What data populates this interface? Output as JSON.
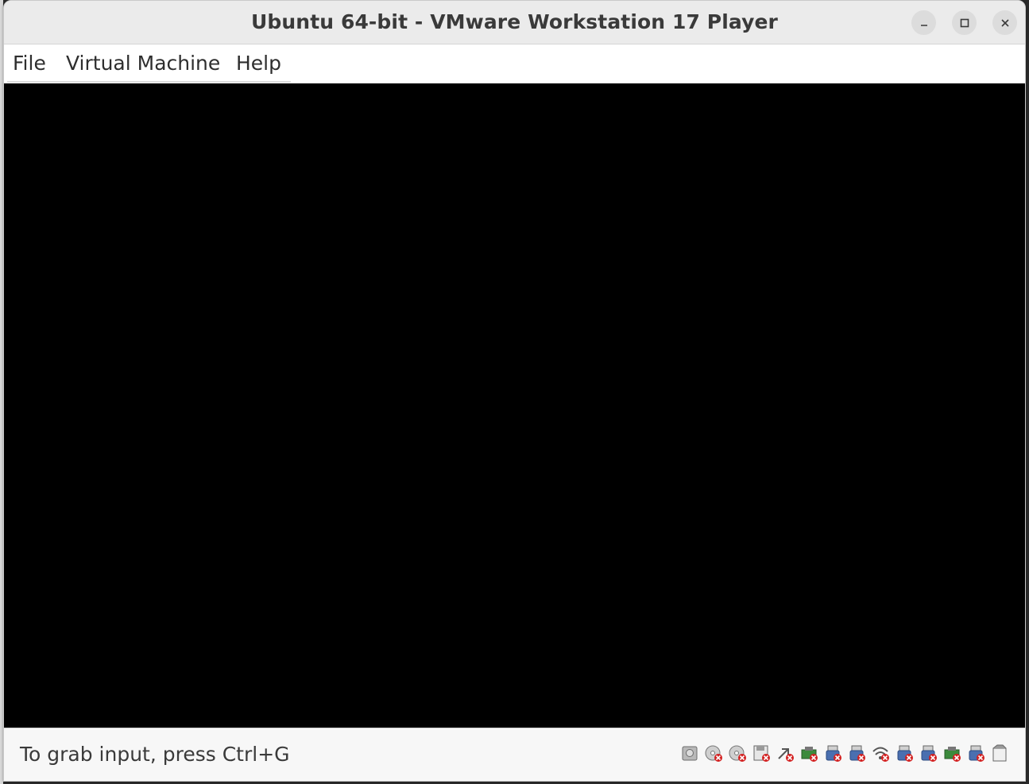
{
  "window": {
    "title": "Ubuntu 64-bit - VMware Workstation 17 Player"
  },
  "window_controls": {
    "minimize": "–",
    "maximize": "□",
    "close": "✕"
  },
  "menubar": {
    "items": [
      {
        "label": "File"
      },
      {
        "label": "Virtual Machine"
      },
      {
        "label": "Help"
      }
    ]
  },
  "statusbar": {
    "text": "To grab input, press Ctrl+G",
    "devices": [
      {
        "icon": "hard-disk-icon",
        "disconnected": false
      },
      {
        "icon": "cd-dvd-icon",
        "disconnected": true
      },
      {
        "icon": "cd-dvd-icon",
        "disconnected": true
      },
      {
        "icon": "floppy-icon",
        "disconnected": true
      },
      {
        "icon": "network-adapter-icon",
        "disconnected": true
      },
      {
        "icon": "network-card-icon",
        "disconnected": true
      },
      {
        "icon": "usb-device-icon",
        "disconnected": true
      },
      {
        "icon": "usb-device-icon",
        "disconnected": true
      },
      {
        "icon": "wireless-icon",
        "disconnected": true
      },
      {
        "icon": "usb-device-icon",
        "disconnected": true
      },
      {
        "icon": "usb-device-icon",
        "disconnected": true
      },
      {
        "icon": "network-card-icon",
        "disconnected": true
      },
      {
        "icon": "usb-device-icon",
        "disconnected": true
      },
      {
        "icon": "message-log-icon",
        "disconnected": false
      }
    ]
  },
  "colors": {
    "vm_screen": "#000000",
    "titlebar": "#ebebeb",
    "disconnected_badge": "#d32020"
  }
}
